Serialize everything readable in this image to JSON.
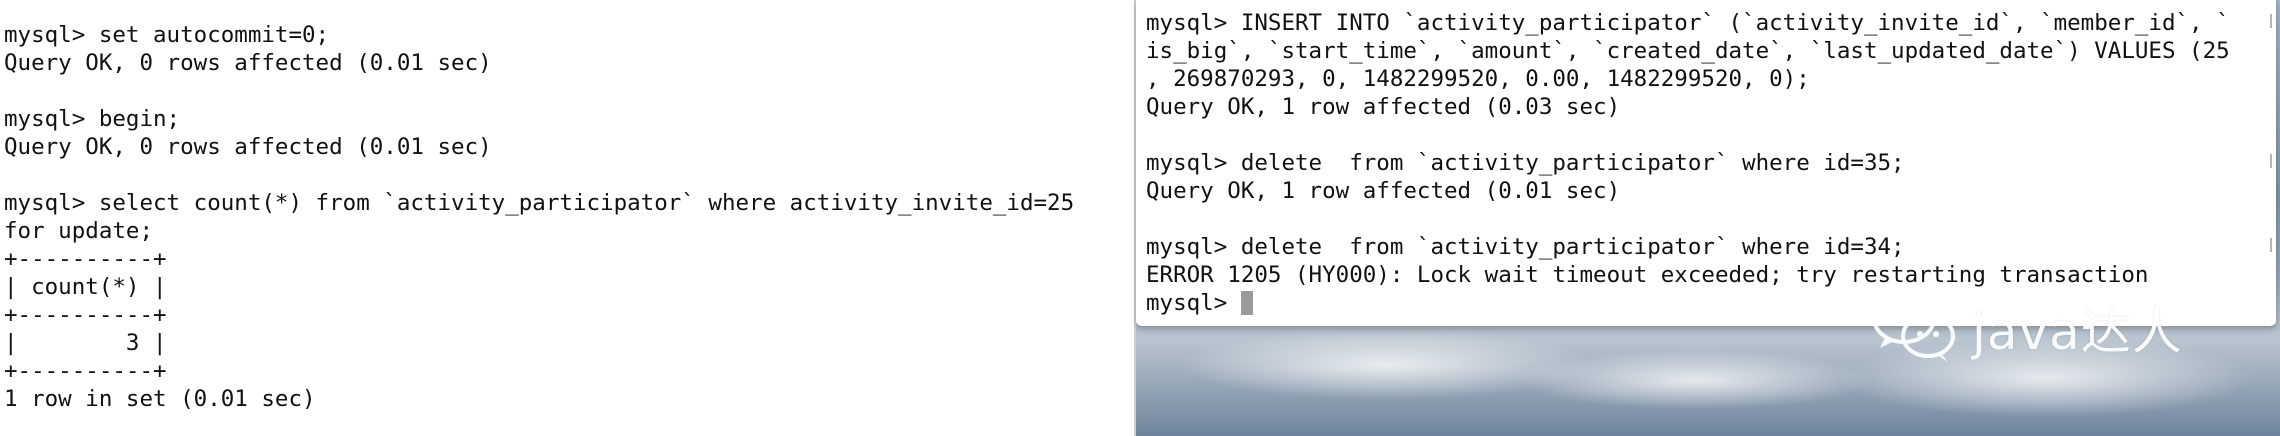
{
  "left_terminal": {
    "lines": [
      "mysql> set autocommit=0;",
      "Query OK, 0 rows affected (0.01 sec)",
      "",
      "mysql> begin;",
      "Query OK, 0 rows affected (0.01 sec)",
      "",
      "mysql> select count(*) from `activity_participator` where activity_invite_id=25",
      "for update;",
      "+----------+",
      "| count(*) |",
      "+----------+",
      "|        3 |",
      "+----------+",
      "1 row in set (0.01 sec)"
    ]
  },
  "right_terminal": {
    "lines": [
      "mysql> INSERT INTO `activity_participator` (`activity_invite_id`, `member_id`, `",
      "is_big`, `start_time`, `amount`, `created_date`, `last_updated_date`) VALUES (25",
      ", 269870293, 0, 1482299520, 0.00, 1482299520, 0);",
      "Query OK, 1 row affected (0.03 sec)",
      "",
      "mysql> delete  from `activity_participator` where id=35;",
      "Query OK, 1 row affected (0.01 sec)",
      "",
      "mysql> delete  from `activity_participator` where id=34;",
      "ERROR 1205 (HY000): Lock wait timeout exceeded; try restarting transaction"
    ],
    "prompt": "mysql> "
  },
  "watermark": {
    "text": "java达人",
    "icon": "wechat-icon"
  },
  "colors": {
    "terminal_bg": "#ffffff",
    "terminal_text": "#111111",
    "cursor": "#9a9a9a",
    "desktop_sky": "#8aa0b6"
  }
}
